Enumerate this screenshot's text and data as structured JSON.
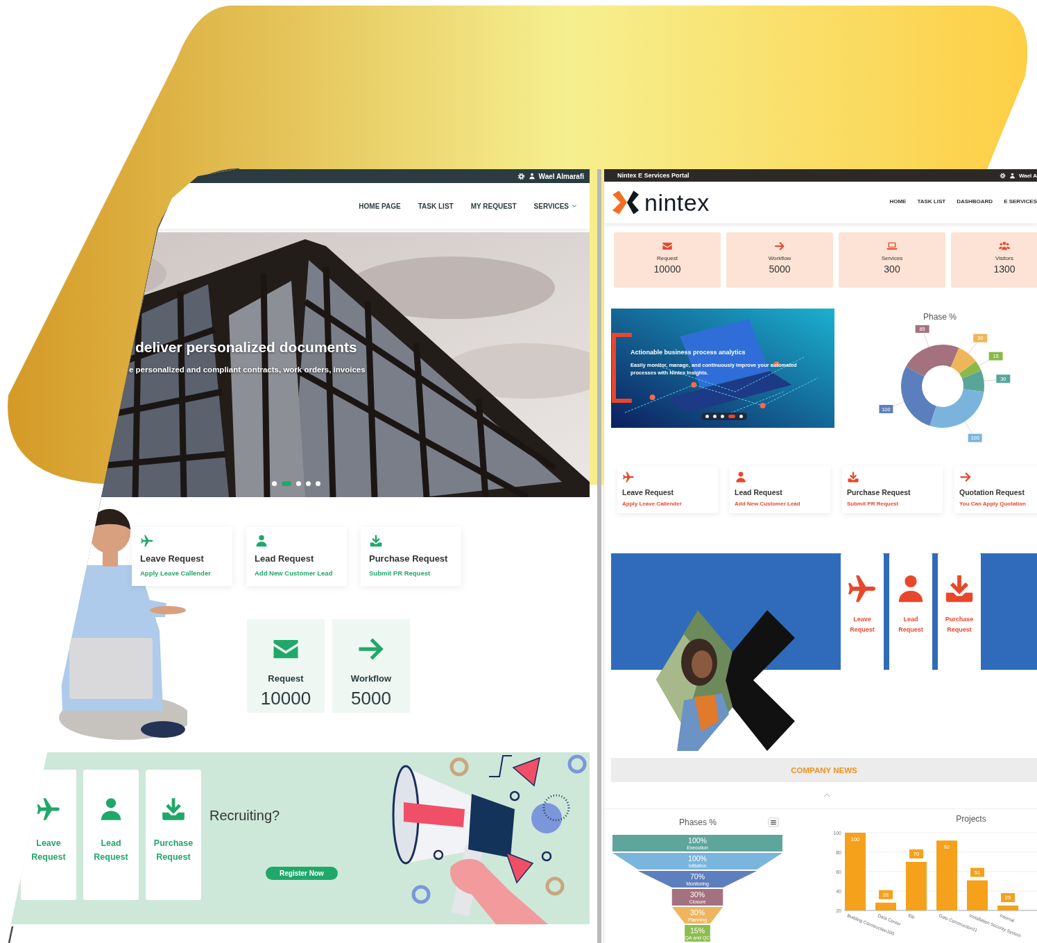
{
  "left_portal": {
    "user_bar": {
      "user_name": "Wael Almarafi"
    },
    "nav": [
      {
        "label": "HOME PAGE",
        "kind": "link"
      },
      {
        "label": "TASK LIST",
        "kind": "link"
      },
      {
        "label": "MY REQUEST",
        "kind": "link"
      },
      {
        "label": "SERVICES",
        "kind": "dropdown"
      }
    ],
    "hero": {
      "heading": "deliver personalized documents",
      "subheading": "e personalized and compliant contracts, work orders, invoices",
      "slides": [
        {
          "selected": false
        },
        {
          "selected": true
        },
        {
          "selected": false
        },
        {
          "selected": false
        },
        {
          "selected": false
        }
      ]
    },
    "services": [
      {
        "title": "Leave Request",
        "link": "Apply Leave Callender"
      },
      {
        "title": "Lead Request",
        "link": "Add New Customer Lead"
      },
      {
        "title": "Purchase Request",
        "link": "Submit PR Request"
      }
    ],
    "stats": [
      {
        "label": "Request",
        "value": "10000"
      },
      {
        "label": "Workflow",
        "value": "5000"
      }
    ],
    "banner": {
      "tiles": [
        {
          "label": "Leave Request"
        },
        {
          "label": "Lead Request"
        },
        {
          "label": "Purchase Request"
        }
      ],
      "heading": "Recruiting?",
      "button": "Register Now"
    }
  },
  "right_portal": {
    "user_bar": {
      "title": "Nintex E Services Portal",
      "user_name": "Wael A"
    },
    "logo": "nintex",
    "nav": [
      {
        "label": "HOME"
      },
      {
        "label": "TASK LIST"
      },
      {
        "label": "DASHBOARD"
      },
      {
        "label": "E SERVICES"
      }
    ],
    "stats": [
      {
        "label": "Request",
        "value": "10000"
      },
      {
        "label": "Workflow",
        "value": "5000"
      },
      {
        "label": "Services",
        "value": "300"
      },
      {
        "label": "Visitors",
        "value": "1300"
      }
    ],
    "carousel": {
      "heading": "Actionable business process analytics",
      "text": "Easily monitor, manage, and continuously improve your automated processes with Nintex Insights.",
      "slides": [
        {
          "selected": false
        },
        {
          "selected": false
        },
        {
          "selected": false
        },
        {
          "selected": true
        },
        {
          "selected": false
        }
      ]
    },
    "phase_chart": {
      "chart_data": {
        "type": "donut",
        "title": "Phase %",
        "values": [
          85,
          30,
          15,
          30,
          100,
          100
        ],
        "data_labels": true
      }
    },
    "services": [
      {
        "title": "Leave Request",
        "link": "Apply Leave Callender"
      },
      {
        "title": "Lead Request",
        "link": "Add New Customer Lead"
      },
      {
        "title": "Purchase Request",
        "link": "Submit PR Request"
      },
      {
        "title": "Quotation Request",
        "link": "You Can Apply Quotation"
      }
    ],
    "tiles": [
      {
        "label": "Leave Request"
      },
      {
        "label": "Lead Request"
      },
      {
        "label": "Purchase Request"
      }
    ],
    "news_heading": "COMPANY NEWS",
    "phases_funnel": {
      "title": "Phases %",
      "stages": [
        {
          "percent": "100%",
          "label": "Execution"
        },
        {
          "percent": "100%",
          "label": "Initiation"
        },
        {
          "percent": "70%",
          "label": "Monitoring"
        },
        {
          "percent": "30%",
          "label": "Closure"
        },
        {
          "percent": "30%",
          "label": "Planning"
        },
        {
          "percent": "15%",
          "label": "QA and QC"
        }
      ]
    },
    "projects_chart": {
      "chart_data": {
        "type": "bar",
        "title": "Projects",
        "categories": [
          "Building Construction100",
          "Data Center",
          "Elir",
          "Gate Construction11",
          "Installation Security System",
          "Internal"
        ],
        "values": [
          100,
          28,
          70,
          92,
          51,
          25
        ],
        "ylim": [
          20,
          100
        ],
        "yticks": [
          20,
          40,
          60,
          80,
          100
        ],
        "grid": true,
        "data_labels": true
      }
    }
  }
}
